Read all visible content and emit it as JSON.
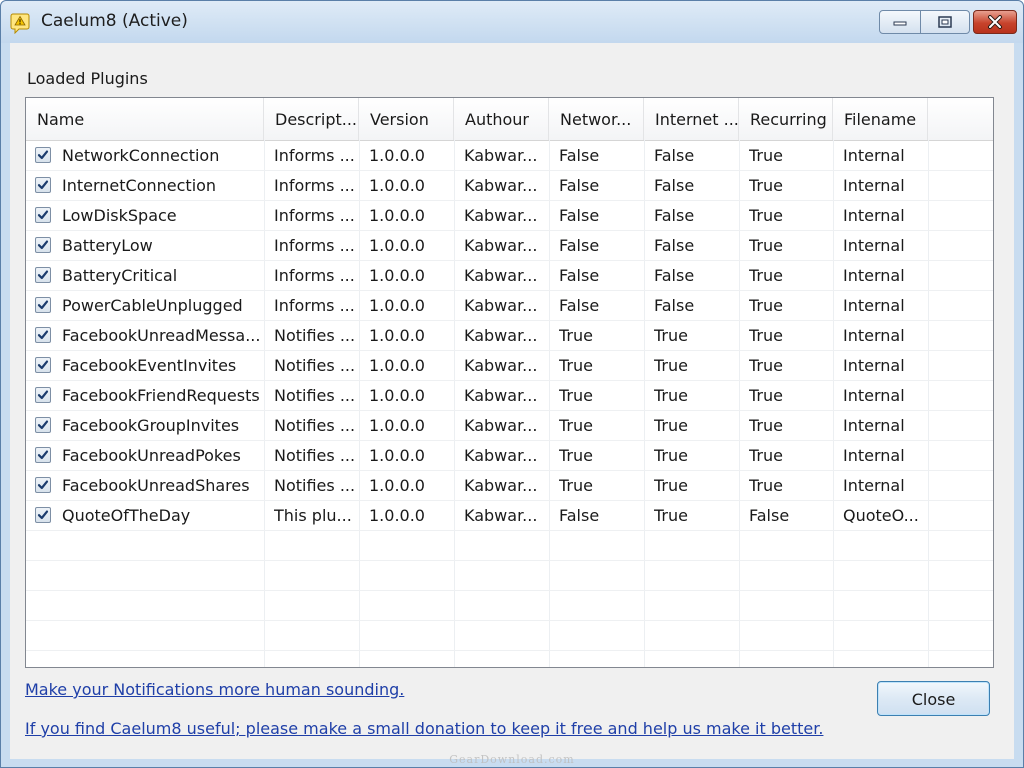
{
  "window": {
    "title": "Caelum8 (Active)",
    "icon": "caelum8-warning-app-icon",
    "controls": [
      "minimize-icon",
      "maximize-icon",
      "close-icon"
    ]
  },
  "plugins_section": {
    "label": "Loaded Plugins",
    "columns": [
      "Name",
      "Descript...",
      "Version",
      "Authour",
      "Networ...",
      "Internet ...",
      "Recurring",
      "Filename"
    ],
    "rows": [
      {
        "checked": true,
        "name": "NetworkConnection",
        "description": "Informs ...",
        "version": "1.0.0.0",
        "author": "Kabwar...",
        "network": "False",
        "internet": "False",
        "recurring": "True",
        "filename": "Internal"
      },
      {
        "checked": true,
        "name": "InternetConnection",
        "description": "Informs ...",
        "version": "1.0.0.0",
        "author": "Kabwar...",
        "network": "False",
        "internet": "False",
        "recurring": "True",
        "filename": "Internal"
      },
      {
        "checked": true,
        "name": "LowDiskSpace",
        "description": "Informs ...",
        "version": "1.0.0.0",
        "author": "Kabwar...",
        "network": "False",
        "internet": "False",
        "recurring": "True",
        "filename": "Internal"
      },
      {
        "checked": true,
        "name": "BatteryLow",
        "description": "Informs ...",
        "version": "1.0.0.0",
        "author": "Kabwar...",
        "network": "False",
        "internet": "False",
        "recurring": "True",
        "filename": "Internal"
      },
      {
        "checked": true,
        "name": "BatteryCritical",
        "description": "Informs ...",
        "version": "1.0.0.0",
        "author": "Kabwar...",
        "network": "False",
        "internet": "False",
        "recurring": "True",
        "filename": "Internal"
      },
      {
        "checked": true,
        "name": "PowerCableUnplugged",
        "description": "Informs ...",
        "version": "1.0.0.0",
        "author": "Kabwar...",
        "network": "False",
        "internet": "False",
        "recurring": "True",
        "filename": "Internal"
      },
      {
        "checked": true,
        "name": "FacebookUnreadMessa...",
        "description": "Notifies ...",
        "version": "1.0.0.0",
        "author": "Kabwar...",
        "network": "True",
        "internet": "True",
        "recurring": "True",
        "filename": "Internal"
      },
      {
        "checked": true,
        "name": "FacebookEventInvites",
        "description": "Notifies ...",
        "version": "1.0.0.0",
        "author": "Kabwar...",
        "network": "True",
        "internet": "True",
        "recurring": "True",
        "filename": "Internal"
      },
      {
        "checked": true,
        "name": "FacebookFriendRequests",
        "description": "Notifies ...",
        "version": "1.0.0.0",
        "author": "Kabwar...",
        "network": "True",
        "internet": "True",
        "recurring": "True",
        "filename": "Internal"
      },
      {
        "checked": true,
        "name": "FacebookGroupInvites",
        "description": "Notifies ...",
        "version": "1.0.0.0",
        "author": "Kabwar...",
        "network": "True",
        "internet": "True",
        "recurring": "True",
        "filename": "Internal"
      },
      {
        "checked": true,
        "name": "FacebookUnreadPokes",
        "description": "Notifies ...",
        "version": "1.0.0.0",
        "author": "Kabwar...",
        "network": "True",
        "internet": "True",
        "recurring": "True",
        "filename": "Internal"
      },
      {
        "checked": true,
        "name": "FacebookUnreadShares",
        "description": "Notifies ...",
        "version": "1.0.0.0",
        "author": "Kabwar...",
        "network": "True",
        "internet": "True",
        "recurring": "True",
        "filename": "Internal"
      },
      {
        "checked": true,
        "name": "QuoteOfTheDay",
        "description": "This plu...",
        "version": "1.0.0.0",
        "author": "Kabwar...",
        "network": "False",
        "internet": "True",
        "recurring": "False",
        "filename": "QuoteO..."
      }
    ]
  },
  "footer": {
    "link_humanize": "Make your Notifications more human sounding.",
    "link_donate": "If you find Caelum8 useful; please make a small donation to keep it free  and help us make  it better.",
    "close_label": "Close"
  },
  "watermark": "GearDownload.com"
}
